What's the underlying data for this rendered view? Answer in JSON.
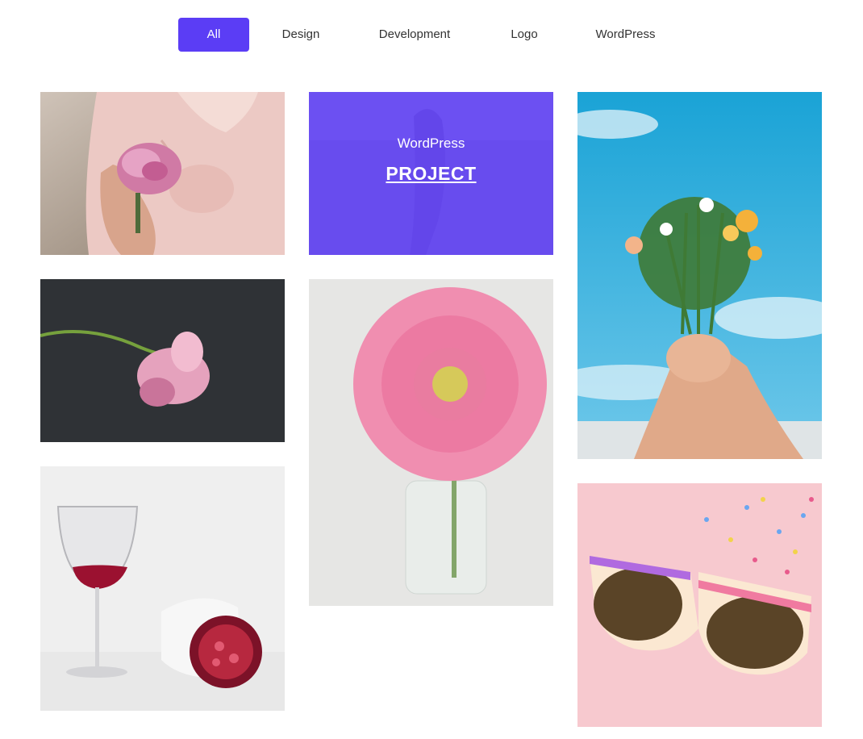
{
  "filters": {
    "items": [
      {
        "label": "All"
      },
      {
        "label": "Design"
      },
      {
        "label": "Development"
      },
      {
        "label": "Logo"
      },
      {
        "label": "WordPress"
      }
    ],
    "active": "All"
  },
  "accent_color": "#5b3df5",
  "portfolio": {
    "items": [
      {
        "image": "woman holding pink peony"
      },
      {
        "image": "figure in lavender field",
        "hover": {
          "category": "WordPress",
          "title": "PROJECT"
        }
      },
      {
        "image": "hands holding flower bouquet against blue sky"
      },
      {
        "image": "pink daisy on dark background"
      },
      {
        "image": "pink gerbera in glass vase"
      },
      {
        "image": "wine glass and pomegranate"
      },
      {
        "image": "sunglasses on pink background with sprinkles"
      }
    ]
  }
}
